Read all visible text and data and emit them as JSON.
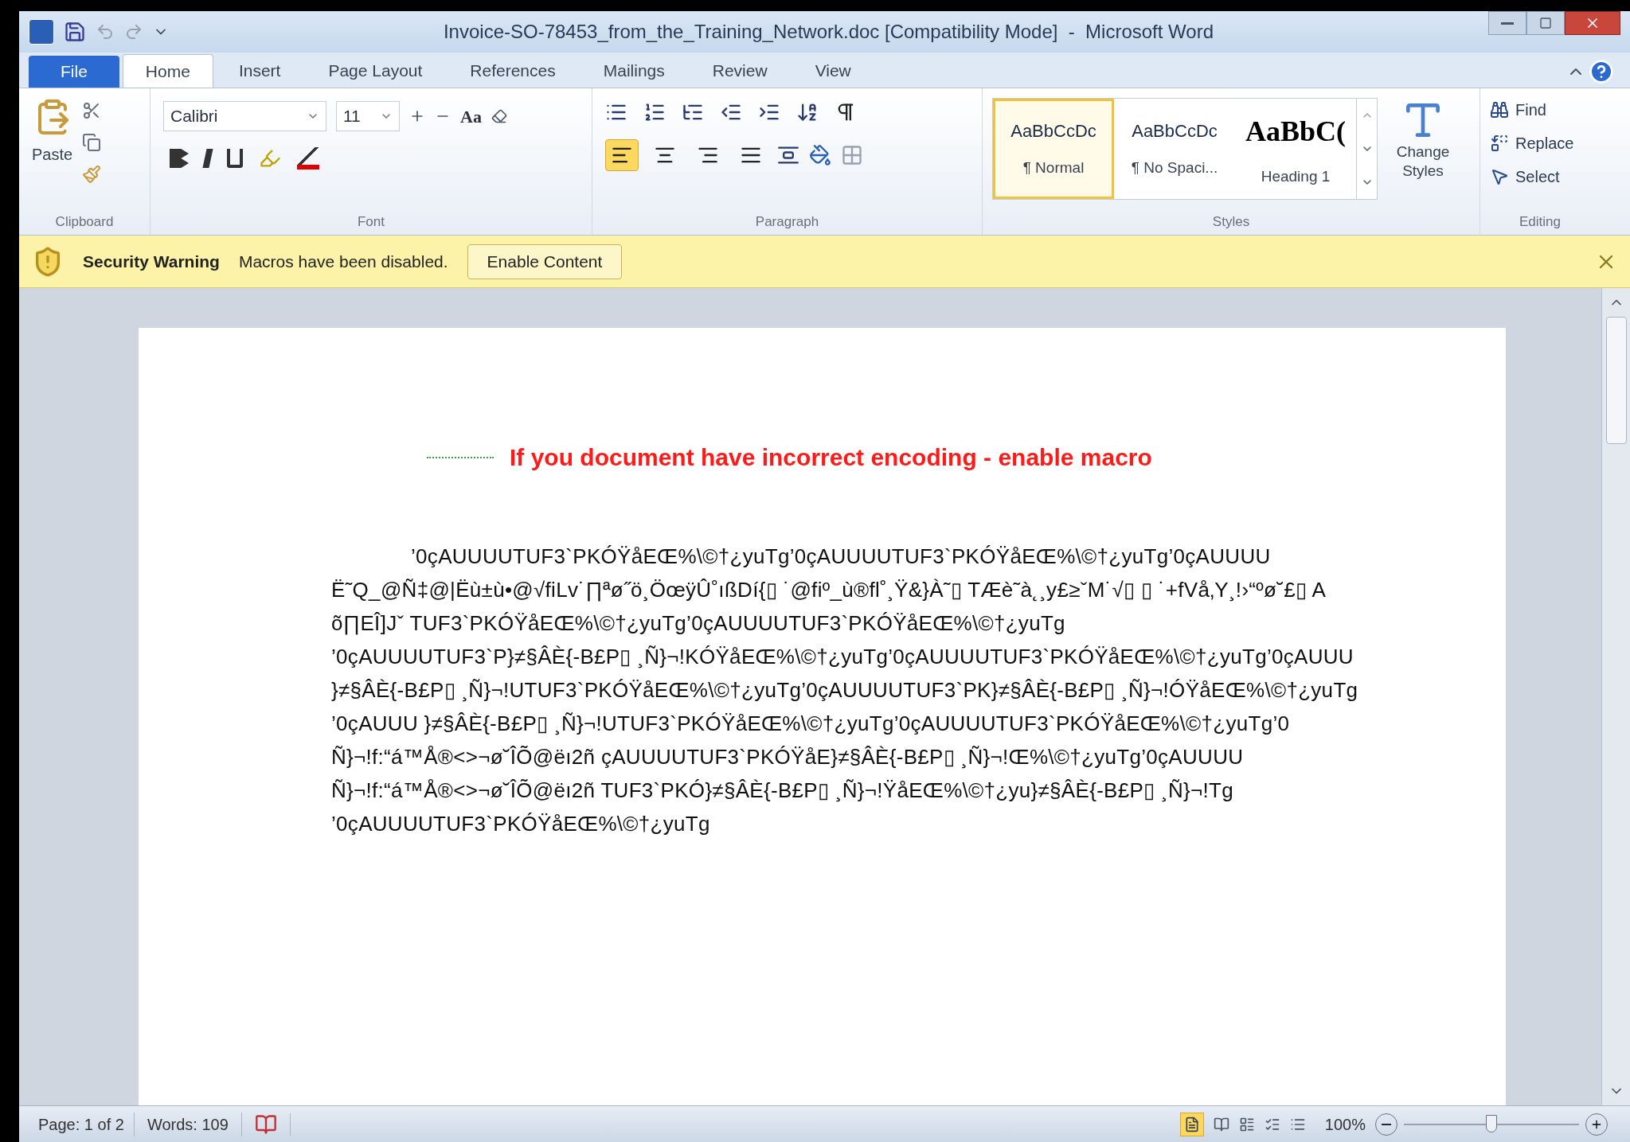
{
  "window": {
    "title": "Invoice-SO-78453_from_the_Training_Network.doc [Compatibility Mode]  -  Microsoft Word"
  },
  "tabs": [
    {
      "label": "File",
      "kind": "file",
      "selected": false
    },
    {
      "label": "Home",
      "kind": "tab",
      "selected": true
    },
    {
      "label": "Insert",
      "kind": "tab",
      "selected": false
    },
    {
      "label": "Page Layout",
      "kind": "tab",
      "selected": false
    },
    {
      "label": "References",
      "kind": "tab",
      "selected": false
    },
    {
      "label": "Mailings",
      "kind": "tab",
      "selected": false
    },
    {
      "label": "Review",
      "kind": "tab",
      "selected": false
    },
    {
      "label": "View",
      "kind": "tab",
      "selected": false
    }
  ],
  "ribbon": {
    "clipboard": {
      "paste": "Paste",
      "label": "Clipboard"
    },
    "font": {
      "name": "Calibri",
      "size": "11",
      "label": "Font",
      "change_case": "Aa"
    },
    "paragraph": {
      "label": "Paragraph",
      "alignments": [
        {
          "kind": "left",
          "selected": true
        },
        {
          "kind": "center",
          "selected": false
        },
        {
          "kind": "right",
          "selected": false
        },
        {
          "kind": "justify",
          "selected": false
        }
      ]
    },
    "styles": {
      "label": "Styles",
      "items": [
        {
          "sample": "AaBbCcDc",
          "name": "¶ Normal",
          "kind": "normal",
          "selected": true
        },
        {
          "sample": "AaBbCcDc",
          "name": "¶ No Spaci...",
          "kind": "normal",
          "selected": false
        },
        {
          "sample": "AaBbC(",
          "name": "Heading 1",
          "kind": "heading",
          "selected": false
        }
      ],
      "change_styles": "Change Styles"
    },
    "editing": {
      "label": "Editing",
      "items": [
        {
          "label": "Find",
          "kind": "find"
        },
        {
          "label": "Replace",
          "kind": "replace"
        },
        {
          "label": "Select",
          "kind": "select"
        }
      ]
    }
  },
  "security_bar": {
    "title": "Security Warning",
    "message": "Macros have been disabled.",
    "button": "Enable Content"
  },
  "document": {
    "heading": "If you document have incorrect encoding - enable macro",
    "lines": [
      "’0çAUUUUTUF3`PKÓŸåEŒ%\\©†¿yuTg’0çAUUUUTUF3`PKÓŸåEŒ%\\©†¿yuTg’0çAUUUU",
      "Ë˜Q_@Ñ‡@|Ëù±ù•@√fiLv˙∏ªø˝ö¸ÖœÿÛ˚ıßDí{▯ ˙@fiº_ù®fl˚¸Ÿ&}À˜▯ TÆè˜à˛¸y£≥ˇM˙√▯ ▯ ˙+fVå‚Y¸!›“ºø˘£▯ A",
      "õ∏EÎ]Jˇ TUF3`PKÓŸåEŒ%\\©†¿yuTg’0çAUUUUTUF3`PKÓŸåEŒ%\\©†¿yuTg",
      "’0çAUUUUTUF3`P}≠§ÂÈ{-B£P▯ ¸Ñ}¬!KÓŸåEŒ%\\©†¿yuTg’0çAUUUUTUF3`PKÓŸåEŒ%\\©†¿yuTg’0çAUUU",
      "}≠§ÂÈ{-B£P▯ ¸Ñ}¬!UTUF3`PKÓŸåEŒ%\\©†¿yuTg’0çAUUUUTUF3`PK}≠§ÂÈ{-B£P▯ ¸Ñ}¬!ÓŸåEŒ%\\©†¿yuTg",
      "’0çAUUU }≠§ÂÈ{-B£P▯ ¸Ñ}¬!UTUF3`PKÓŸåEŒ%\\©†¿yuTg’0çAUUUUTUF3`PKÓŸåEŒ%\\©†¿yuTg’0",
      "Ñ}¬!f:“á™Å®<>¬ø˘ÎÕ@ëı2ñ çAUUUUTUF3`PKÓŸåE}≠§ÂÈ{-B£P▯ ¸Ñ}¬!Œ%\\©†¿yuTg’0çAUUUU",
      "Ñ}¬!f:“á™Å®<>¬ø˘ÎÕ@ëı2ñ TUF3`PKÓ}≠§ÂÈ{-B£P▯ ¸Ñ}¬!ŸåEŒ%\\©†¿yu}≠§ÂÈ{-B£P▯ ¸Ñ}¬!Tg",
      "’0çAUUUUTUF3`PKÓŸåEŒ%\\©†¿yuTg"
    ]
  },
  "status_bar": {
    "page": "Page: 1 of 2",
    "words": "Words: 109",
    "zoom": "100%",
    "zoom_level": {
      "level": 0.5
    }
  }
}
